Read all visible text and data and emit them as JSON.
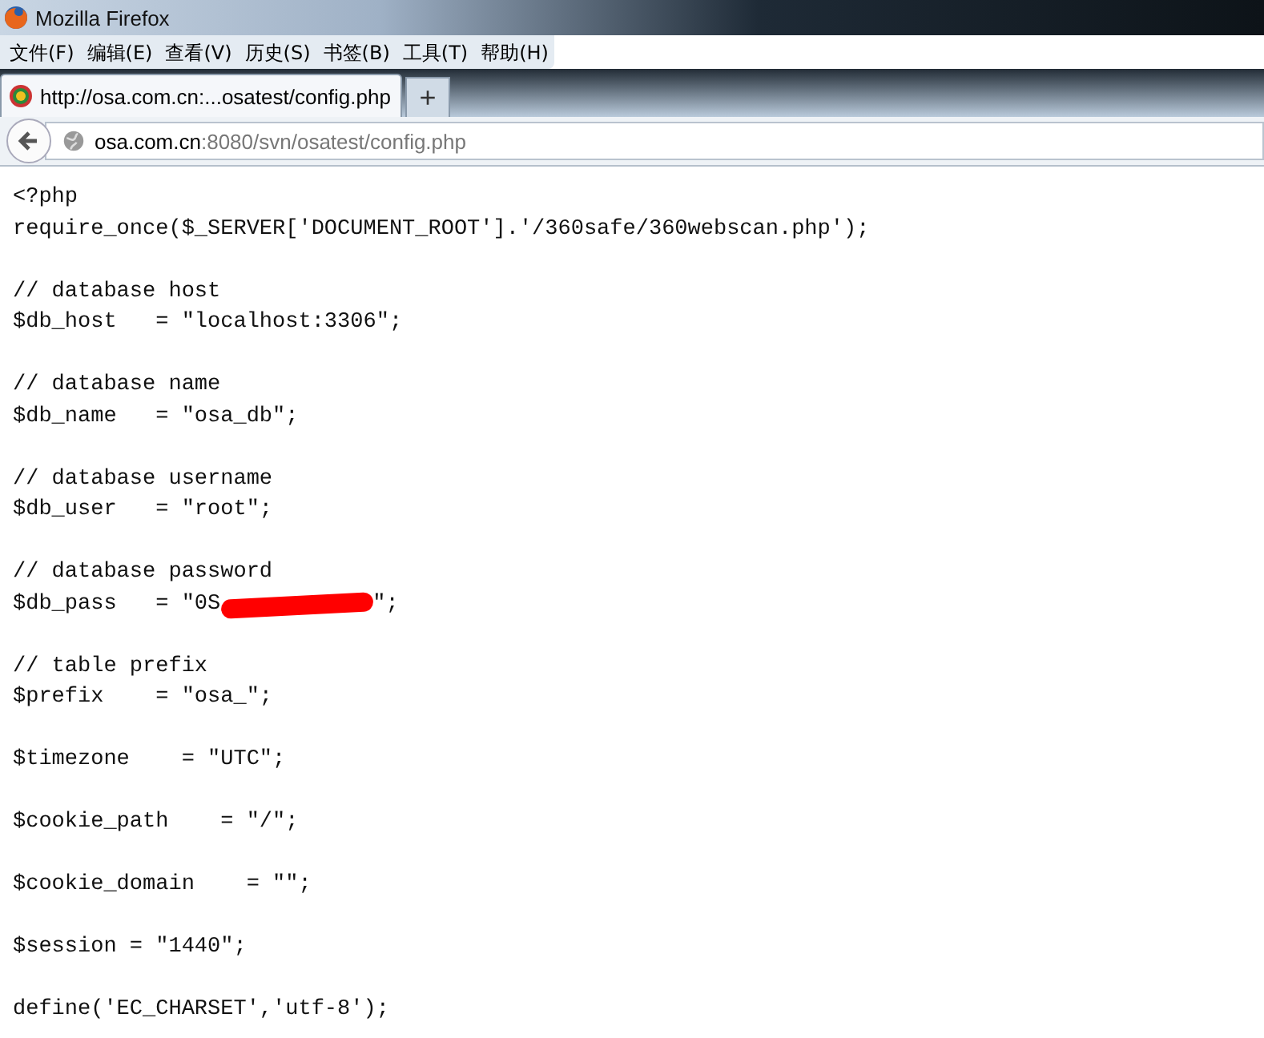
{
  "window": {
    "title": "Mozilla Firefox"
  },
  "menu": [
    "文件(F)",
    "编辑(E)",
    "查看(V)",
    "历史(S)",
    "书签(B)",
    "工具(T)",
    "帮助(H)"
  ],
  "tabs": [
    {
      "label": "http://osa.com.cn:...osatest/config.php",
      "selected": true
    }
  ],
  "new_tab": "+",
  "address": {
    "host": "osa.com.cn",
    "path": ":8080/svn/osatest/config.php"
  },
  "code_blocks": [
    [
      {
        "text": "<?php"
      },
      {
        "text": "require_once($_SERVER['DOCUMENT_ROOT'].'/360safe/360webscan.php');"
      }
    ],
    [
      {
        "text": "// database host"
      },
      {
        "text": "$db_host   = \"localhost:3306\";"
      }
    ],
    [
      {
        "text": "// database name"
      },
      {
        "text": "$db_name   = \"osa_db\";"
      }
    ],
    [
      {
        "text": "// database username"
      },
      {
        "text": "$db_user   = \"root\";"
      }
    ],
    [
      {
        "text": "// database password"
      },
      {
        "text": "$db_pass   = \"0S",
        "redacted": true,
        "tail": "\";"
      }
    ],
    [
      {
        "text": "// table prefix"
      },
      {
        "text": "$prefix    = \"osa_\";"
      }
    ],
    [
      {
        "text": "$timezone    = \"UTC\";"
      }
    ],
    [
      {
        "text": "$cookie_path    = \"/\";"
      }
    ],
    [
      {
        "text": "$cookie_domain    = \"\";"
      }
    ],
    [
      {
        "text": "$session = \"1440\";"
      }
    ],
    [
      {
        "text": "define('EC_CHARSET','utf-8');"
      }
    ]
  ]
}
